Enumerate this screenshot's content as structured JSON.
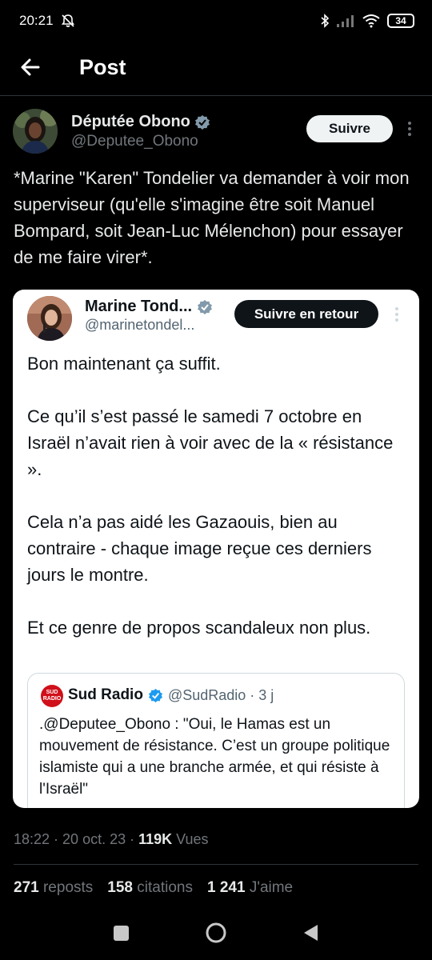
{
  "status_bar": {
    "time": "20:21",
    "battery": "34",
    "icons": [
      "muted-bell-icon",
      "bluetooth-icon",
      "signal-icon",
      "wifi-icon",
      "battery-icon"
    ]
  },
  "header": {
    "title": "Post"
  },
  "author": {
    "name": "Députée Obono",
    "handle": "@Deputee_Obono",
    "follow_label": "Suivre",
    "verified_color": "#829aab"
  },
  "tweet": {
    "text": "*Marine \"Karen\" Tondelier va demander à voir mon superviseur (qu'elle s'imagine être soit Manuel Bompard, soit Jean-Luc Mélenchon) pour essayer de me faire virer*."
  },
  "quote": {
    "name": "Marine Tond...",
    "handle": "@marinetondel...",
    "follow_label": "Suivre en retour",
    "paragraphs": [
      "Bon maintenant ça suffit.",
      "Ce qu’il s’est passé le samedi 7 octobre en Israël n’avait rien à voir avec de la « résistance ».",
      "Cela n’a pas aidé les Gazaouis, bien au contraire - chaque image reçue ces derniers jours le montre.",
      "Et ce genre de propos scandaleux non plus."
    ],
    "nested": {
      "logo_top": "SUD",
      "logo_bottom": "RADIO",
      "name": "Sud Radio",
      "handle": "@SudRadio · 3 j",
      "text": ".@Deputee_Obono : \"Oui, le Hamas est un mouvement de résistance. C’est un groupe politique islamiste qui a une branche armée, et qui résiste à l'Israël\""
    }
  },
  "meta": {
    "timestamp": "18:22 · 20 oct. 23 · ",
    "views": "119K",
    "views_label": " Vues"
  },
  "stats": {
    "reposts": "271",
    "reposts_label": "reposts",
    "quotes": "158",
    "quotes_label": "citations",
    "likes": "1 241",
    "likes_label": "J'aime"
  }
}
